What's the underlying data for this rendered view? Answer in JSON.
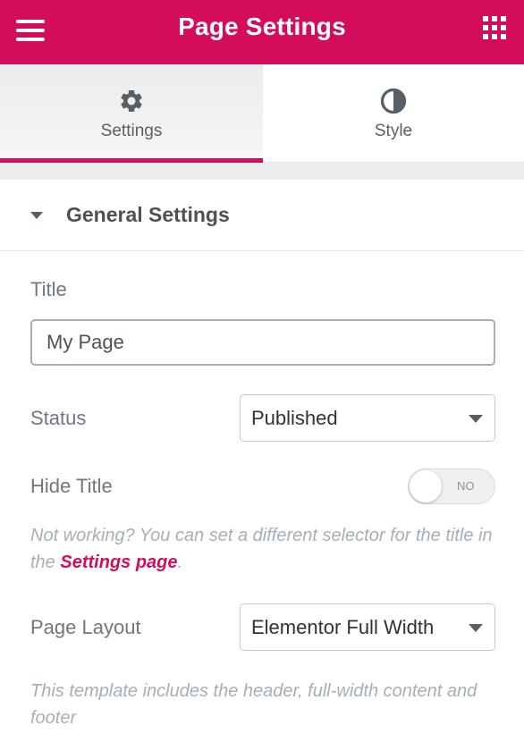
{
  "header": {
    "title": "Page Settings",
    "menu_icon": "hamburger-icon",
    "apps_icon": "grid-icon",
    "accent_color": "#d30c5c"
  },
  "tabs": [
    {
      "label": "Settings",
      "icon": "gear-icon",
      "active": true
    },
    {
      "label": "Style",
      "icon": "half-circle-icon",
      "active": false
    }
  ],
  "section": {
    "title": "General Settings",
    "expanded": true
  },
  "fields": {
    "title": {
      "label": "Title",
      "value": "My Page"
    },
    "status": {
      "label": "Status",
      "value": "Published"
    },
    "hide_title": {
      "label": "Hide Title",
      "switch_text": "NO",
      "on": false,
      "help_prefix": "Not working? You can set a different selector for the title in the ",
      "help_link": "Settings page",
      "help_suffix": "."
    },
    "page_layout": {
      "label": "Page Layout",
      "value": "Elementor Full Width",
      "help": "This template includes the header, full-width content and footer"
    }
  }
}
